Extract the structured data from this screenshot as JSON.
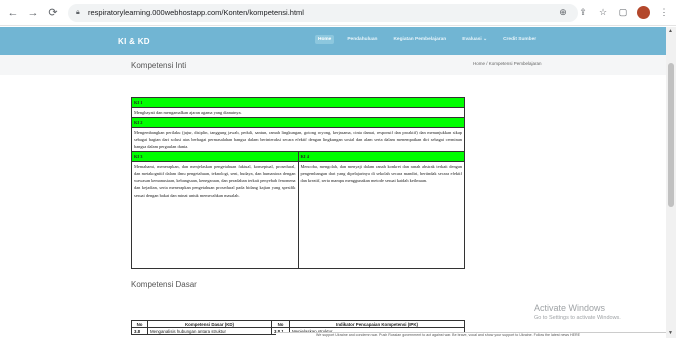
{
  "browser": {
    "url": "respiratorylearning.000webhostapp.com/Konten/kompetensi.html"
  },
  "header": {
    "brand": "KI & KD",
    "menu": [
      "Home",
      "Pendahuluan",
      "Kegiatan Pembelajaran",
      "Evaluasi ⌄",
      "Credit Sumber"
    ]
  },
  "page": {
    "section_title": "Kompetensi Inti",
    "breadcrumb": "Home / Kompetensi Pembelajaran"
  },
  "ki": {
    "ki1_head": "KI 1",
    "ki1_text": "Menghayati dan mengamalkan ajaran agama yang dianutnya.",
    "ki2_head": "KI 2",
    "ki2_text": "Mengembangkan perilaku (jujur, disiplin, tanggung jawab, peduli, santun, ramah lingkungan, gotong royong, kerjasama, cinta damai, responsif dan proaktif) dan menunjukkan sikap sebagai bagian dari solusi atas berbagai permasalahan bangsa dalam berinteraksi secara efektif dengan lingkungan sosial dan alam serta dalam menempatkan diri sebagai cerminan bangsa dalam pergaulan dunia.",
    "ki3_head": "KI 3",
    "ki3_text": "Memahami, menerapkan, dan menjelaskan pengetahuan faktual, konseptual, prosedural, dan metakognitif dalam ilmu pengetahuan, teknologi, seni, budaya, dan humaniora dengan wawasan kemanusiaan, kebangsaan, kenegaraan, dan peradaban terkait penyebab fenomena dan kejadian, serta menerapkan pengetahuan prosedural pada bidang kajian yang spesifik sesuai dengan bakat dan minat untuk memecahkan masalah.",
    "ki4_head": "KI 4",
    "ki4_text": "Mencoba, mengolah, dan menyaji dalam ranah konkret dan ranah abstrak terkait dengan pengembangan dari yang dipelajarinya di sekolah secara mandiri, bertindak secara efektif dan kreatif, serta mampu menggunakan metode sesuai kaidah keilmuan."
  },
  "kd": {
    "title": "Kompetensi Dasar",
    "headers": [
      "No",
      "Kompetensi Dasar (KD)",
      "No",
      "Indikator Pencapaian Kompetensi (IPK)"
    ],
    "row1": [
      "3.8",
      "Menganalisis hubungan antara struktur",
      "3.8.1",
      "Menjelaskan struktur"
    ]
  },
  "watermark": {
    "title": "Activate Windows",
    "subtitle": "Go to Settings to activate Windows."
  },
  "notice": "We support Ukraine and condemn war. Push Russian government to act against war. Be brave, vocal and show your support to Ukraine. Follow the latest news HERE"
}
